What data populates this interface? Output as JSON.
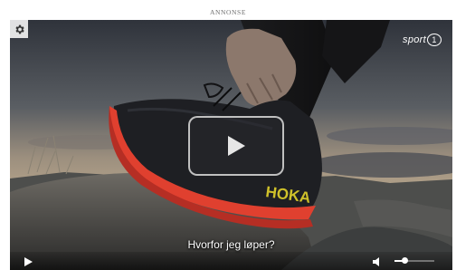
{
  "ad": {
    "label": "ANNONSE"
  },
  "player": {
    "brand_text": "sport",
    "brand_number": "1",
    "title": "Hvorfor jeg løper?",
    "controls": {
      "volume_level": 0.25
    },
    "icons": {
      "settings": "gear-icon",
      "big_play": "play-icon",
      "small_play": "play-icon",
      "volume": "speaker-icon"
    },
    "colors": {
      "shoe_sole": "#e0402f",
      "shoe_brand": "#cfc12a",
      "control_bar": "#0b0d10"
    }
  }
}
